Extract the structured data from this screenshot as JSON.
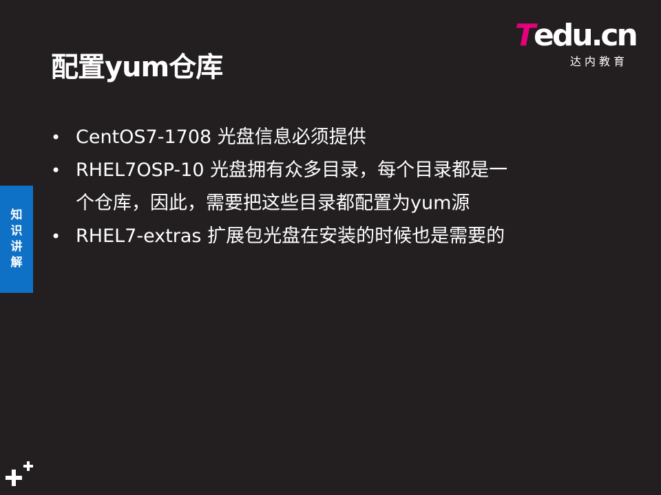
{
  "slide": {
    "title": "配置yum仓库"
  },
  "logo": {
    "main_t": "T",
    "main_rest": "edu",
    "main_cn": ".cn",
    "subtitle": "达内教育"
  },
  "side_tab": {
    "chars": [
      "知",
      "识",
      "讲",
      "解"
    ]
  },
  "bullets": [
    {
      "marker": "•",
      "lines": [
        "CentOS7-1708 光盘信息必须提供"
      ]
    },
    {
      "marker": "•",
      "lines": [
        "RHEL7OSP-10 光盘拥有众多目录，每个目录都是一",
        "个仓库，因此，需要把这些目录都配置为yum源"
      ]
    },
    {
      "marker": "•",
      "lines": [
        "RHEL7-extras 扩展包光盘在安装的时候也是需要的"
      ]
    }
  ],
  "colors": {
    "background": "#231f20",
    "accent_blue": "#0e71c6",
    "logo_magenta": "#e6007e",
    "text": "#ffffff"
  },
  "icons": {
    "corner": "plus-plus-icon"
  }
}
